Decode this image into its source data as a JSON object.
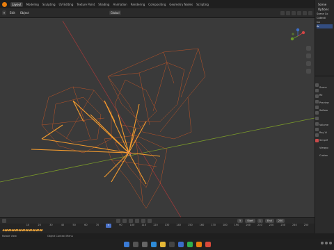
{
  "workspaces": [
    "Layout",
    "Modeling",
    "Sculpting",
    "UV Editing",
    "Texture Paint",
    "Shading",
    "Animation",
    "Rendering",
    "Compositing",
    "Geometry Nodes",
    "Scripting"
  ],
  "active_workspace": "Layout",
  "header": {
    "mode_label": "Edit",
    "menu_object": "Object",
    "orientation": "Global"
  },
  "right_panel": {
    "scene_label": "Scene",
    "options_label": "Options",
    "outliner_rows": [
      "Scene Co",
      "Collecti",
      "Ca",
      "Ar"
    ],
    "props_rows": [
      "Scene",
      "Re",
      "Preview",
      "Softwa",
      "Volume",
      "Ray Vi",
      "Simplif",
      "Viewpo",
      "Custon"
    ]
  },
  "timeline": {
    "frame_current": "5",
    "start_label": "Start",
    "start_value": "1",
    "end_label": "End",
    "end_value": "250",
    "ticks": [
      "10",
      "20",
      "30",
      "40",
      "50",
      "60",
      "70",
      "80",
      "90",
      "100",
      "110",
      "120",
      "130",
      "140",
      "150",
      "160",
      "170",
      "180",
      "190",
      "200",
      "210",
      "220",
      "230",
      "240",
      "250"
    ],
    "playhead_label": "5"
  },
  "statusbar": {
    "left": "Rotate View",
    "middle": "Object Context Menu"
  },
  "taskbar": {
    "icons": [
      "start-icon",
      "search-icon",
      "taskview-icon",
      "edge-icon",
      "explorer-icon",
      "store-icon",
      "mail-icon",
      "spotify-icon",
      "blender-icon",
      "chrome-icon"
    ]
  },
  "colors": {
    "accent": "#e87d0d",
    "wire": "#e0652a",
    "bone": "#f39b2e",
    "grid_x": "#9a3a3a",
    "grid_y": "#7a9a2a"
  }
}
